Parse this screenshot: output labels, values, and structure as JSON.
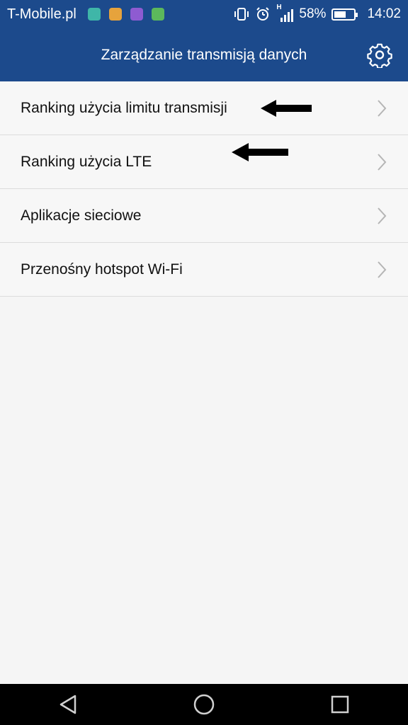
{
  "status_bar": {
    "carrier": "T-Mobile.pl",
    "notification_icons": [
      {
        "name": "chat-app-icon",
        "color": "#3fb6a8"
      },
      {
        "name": "sim-card-icon",
        "color": "#e6a33c"
      },
      {
        "name": "gallery-icon",
        "color": "#8e5bd1"
      },
      {
        "name": "battery-app-icon",
        "color": "#5cb85c"
      }
    ],
    "network_type": "H",
    "battery_percent": "58%",
    "battery_level": 0.58,
    "time": "14:02"
  },
  "app_bar": {
    "title": "Zarządzanie transmisją danych",
    "settings_icon": "gear-icon"
  },
  "menu": {
    "items": [
      {
        "label": "Ranking użycia limitu transmisji"
      },
      {
        "label": "Ranking użycia LTE"
      },
      {
        "label": "Aplikacje sieciowe"
      },
      {
        "label": "Przenośny hotspot Wi-Fi"
      }
    ]
  },
  "navigation": {
    "back_icon": "back-triangle-icon",
    "home_icon": "home-circle-icon",
    "recents_icon": "recents-square-icon"
  },
  "colors": {
    "header_bg": "#1c4a8c",
    "list_bg": "#f7f7f7",
    "nav_bg": "#000000"
  }
}
